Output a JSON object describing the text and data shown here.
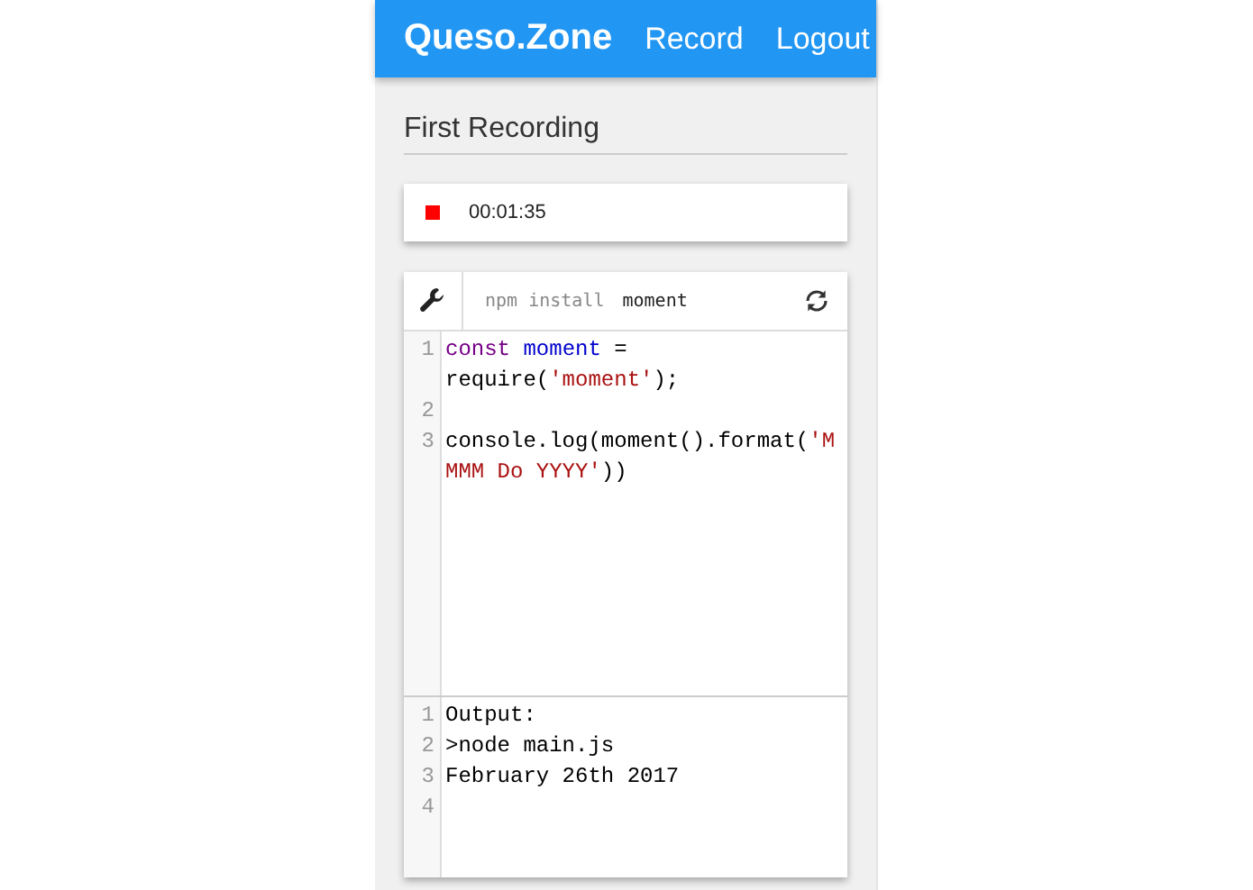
{
  "header": {
    "brand": "Queso.Zone",
    "links": [
      "Record",
      "Logout"
    ]
  },
  "title": "First Recording",
  "recording": {
    "recording": true,
    "time": "00:01:35"
  },
  "editor": {
    "command": "npm install",
    "package": "moment",
    "code": [
      {
        "number": "1",
        "tokens": [
          {
            "text": "const ",
            "kind": "keyword"
          },
          {
            "text": "moment",
            "kind": "variable"
          },
          {
            "text": " = require(",
            "kind": "plain"
          },
          {
            "text": "'moment'",
            "kind": "string"
          },
          {
            "text": ");",
            "kind": "plain"
          }
        ]
      },
      {
        "number": "2"
      },
      {
        "number": "3",
        "tokens": [
          {
            "text": "console.log(moment().format(",
            "kind": "plain"
          },
          {
            "text": "'MMMM Do YYYY'",
            "kind": "string"
          },
          {
            "text": "))",
            "kind": "plain"
          }
        ]
      }
    ],
    "output": [
      {
        "number": "1",
        "text": "Output:"
      },
      {
        "number": "2",
        "text": ">node main.js"
      },
      {
        "number": "3",
        "text": "February 26th 2017"
      },
      {
        "number": "4"
      }
    ]
  }
}
